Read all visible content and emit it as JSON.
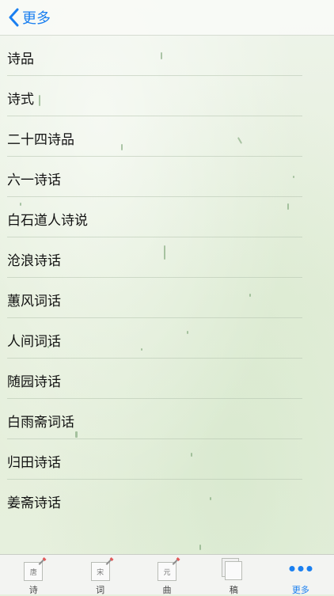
{
  "nav": {
    "back_label": "更多"
  },
  "list": {
    "items": [
      "诗品",
      "诗式",
      "二十四诗品",
      "六一诗话",
      "白石道人诗说",
      "沧浪诗话",
      "蕙风词话",
      "人间词话",
      "随园诗话",
      "白雨斋词话",
      "归田诗话",
      "姜斋诗话"
    ]
  },
  "tabbar": {
    "tabs": [
      {
        "label": "诗",
        "icon_text": "唐",
        "icon": "tang-doc-icon"
      },
      {
        "label": "词",
        "icon_text": "宋",
        "icon": "song-doc-icon"
      },
      {
        "label": "曲",
        "icon_text": "元",
        "icon": "yuan-doc-icon"
      },
      {
        "label": "稿",
        "icon": "stack-icon"
      },
      {
        "label": "更多",
        "icon": "more-dots-icon",
        "active": true
      }
    ]
  },
  "colors": {
    "accent": "#1a7ff0",
    "background": "#e6f0dd"
  }
}
